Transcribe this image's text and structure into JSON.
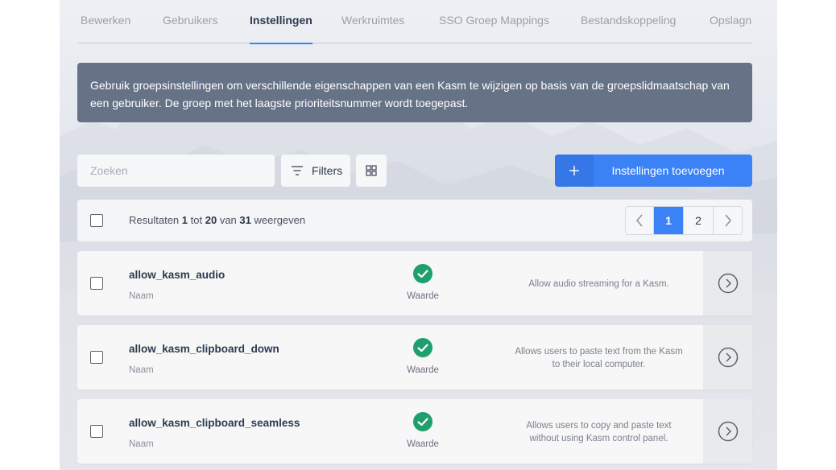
{
  "tabs": [
    {
      "label": "Bewerken"
    },
    {
      "label": "Gebruikers"
    },
    {
      "label": "Instellingen"
    },
    {
      "label": "Werkruimtes"
    },
    {
      "label": "SSO Groep Mappings"
    },
    {
      "label": "Bestandskoppeling"
    },
    {
      "label": "Opslagn"
    }
  ],
  "active_tab": "Instellingen",
  "info_text": "Gebruik groepsinstellingen om verschillende eigenschappen van een Kasm te wijzigen op basis van de groepslidmaatschap van een gebruiker. De groep met het laagste prioriteitsnummer wordt toegepast.",
  "search": {
    "placeholder": "Zoeken",
    "value": ""
  },
  "filters_label": "Filters",
  "add_button": {
    "icon": "plus-icon",
    "label": "Instellingen toevoegen"
  },
  "results": {
    "prefix": "Resultaten",
    "from": "1",
    "mid": "tot",
    "to": "20",
    "of": "van",
    "total": "31",
    "suffix": "weergeven"
  },
  "pagination": {
    "prev_icon": "chevron-left-icon",
    "pages": [
      "1",
      "2"
    ],
    "current": "1",
    "next_icon": "chevron-right-icon"
  },
  "rows": [
    {
      "name": "allow_kasm_audio",
      "name_label": "Naam",
      "value_label": "Waarde",
      "value_enabled": true,
      "description": "Allow audio streaming for a Kasm."
    },
    {
      "name": "allow_kasm_clipboard_down",
      "name_label": "Naam",
      "value_label": "Waarde",
      "value_enabled": true,
      "description": "Allows users to paste text from the Kasm to their local computer."
    },
    {
      "name": "allow_kasm_clipboard_seamless",
      "name_label": "Naam",
      "value_label": "Waarde",
      "value_enabled": true,
      "description": "Allows users to copy and paste text without using Kasm control panel."
    }
  ],
  "colors": {
    "accent": "#3b82f6",
    "info_bg": "#667387",
    "check_green": "#1f9e6e"
  }
}
